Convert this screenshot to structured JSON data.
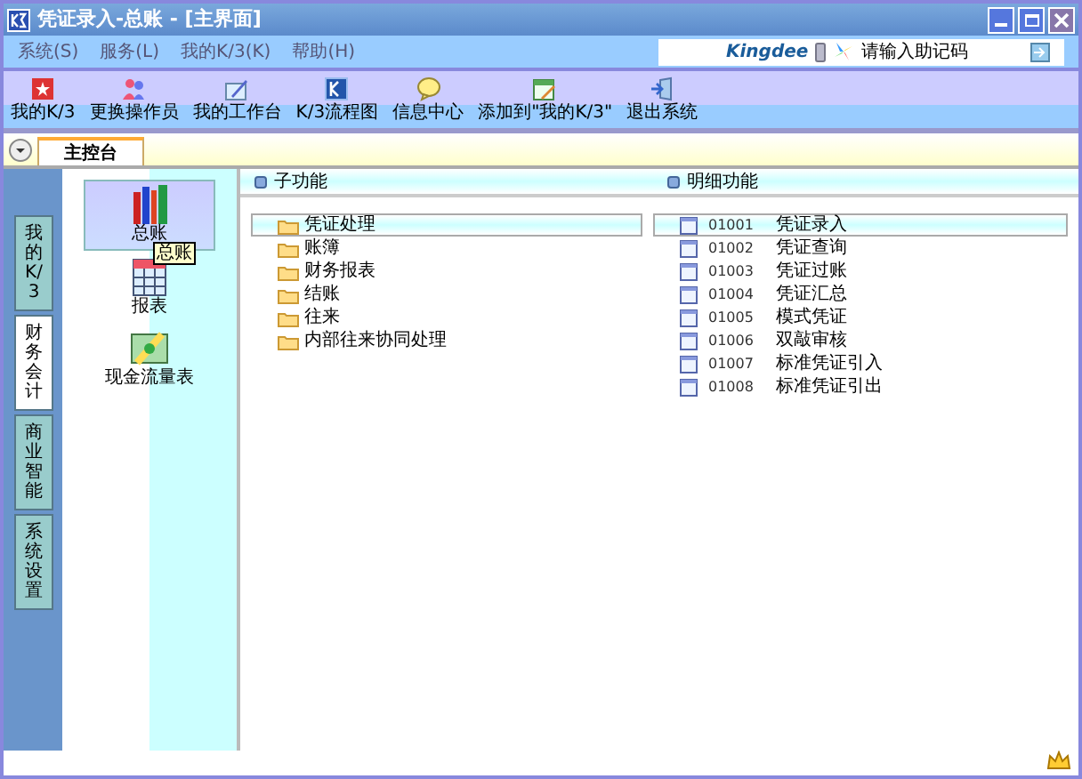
{
  "window": {
    "title": "凭证录入-总账 - [主界面]"
  },
  "menu": [
    {
      "label": "系统(S)"
    },
    {
      "label": "服务(L)"
    },
    {
      "label": "我的K/3(K)"
    },
    {
      "label": "帮助(H)"
    }
  ],
  "search": {
    "brand": "Kingdee",
    "placeholder": "请输入助记码"
  },
  "toolbar": [
    {
      "label": "我的K/3",
      "kind": "star"
    },
    {
      "label": "更换操作员",
      "kind": "people"
    },
    {
      "label": "我的工作台",
      "kind": "pen"
    },
    {
      "label": "K/3流程图",
      "kind": "k3"
    },
    {
      "label": "信息中心",
      "kind": "chat"
    },
    {
      "label": "添加到\"我的K/3\"",
      "kind": "add"
    },
    {
      "label": "退出系统",
      "kind": "exit"
    }
  ],
  "doc_tabs": [
    {
      "label": "主控台",
      "selected": true
    }
  ],
  "side_tabs": [
    {
      "label": "我的K/3",
      "selected": false
    },
    {
      "label": "财务会计",
      "selected": true
    },
    {
      "label": "商业智能",
      "selected": false
    },
    {
      "label": "系统设置",
      "selected": false
    }
  ],
  "modules": [
    {
      "label": "总账",
      "kind": "books",
      "selected": true,
      "tooltip": "总账"
    },
    {
      "label": "报表",
      "kind": "report",
      "selected": false
    },
    {
      "label": "现金流量表",
      "kind": "cash",
      "selected": false
    }
  ],
  "sub_functions": {
    "title": "子功能",
    "items": [
      {
        "label": "凭证处理",
        "selected": true
      },
      {
        "label": "账簿",
        "selected": false
      },
      {
        "label": "财务报表",
        "selected": false
      },
      {
        "label": "结账",
        "selected": false
      },
      {
        "label": "往来",
        "selected": false
      },
      {
        "label": "内部往来协同处理",
        "selected": false
      }
    ]
  },
  "detail_functions": {
    "title": "明细功能",
    "items": [
      {
        "code": "01001",
        "label": "凭证录入",
        "selected": true
      },
      {
        "code": "01002",
        "label": "凭证查询",
        "selected": false
      },
      {
        "code": "01003",
        "label": "凭证过账",
        "selected": false
      },
      {
        "code": "01004",
        "label": "凭证汇总",
        "selected": false
      },
      {
        "code": "01005",
        "label": "模式凭证",
        "selected": false
      },
      {
        "code": "01006",
        "label": "双敲审核",
        "selected": false
      },
      {
        "code": "01007",
        "label": "标准凭证引入",
        "selected": false
      },
      {
        "code": "01008",
        "label": "标准凭证引出",
        "selected": false
      }
    ]
  }
}
